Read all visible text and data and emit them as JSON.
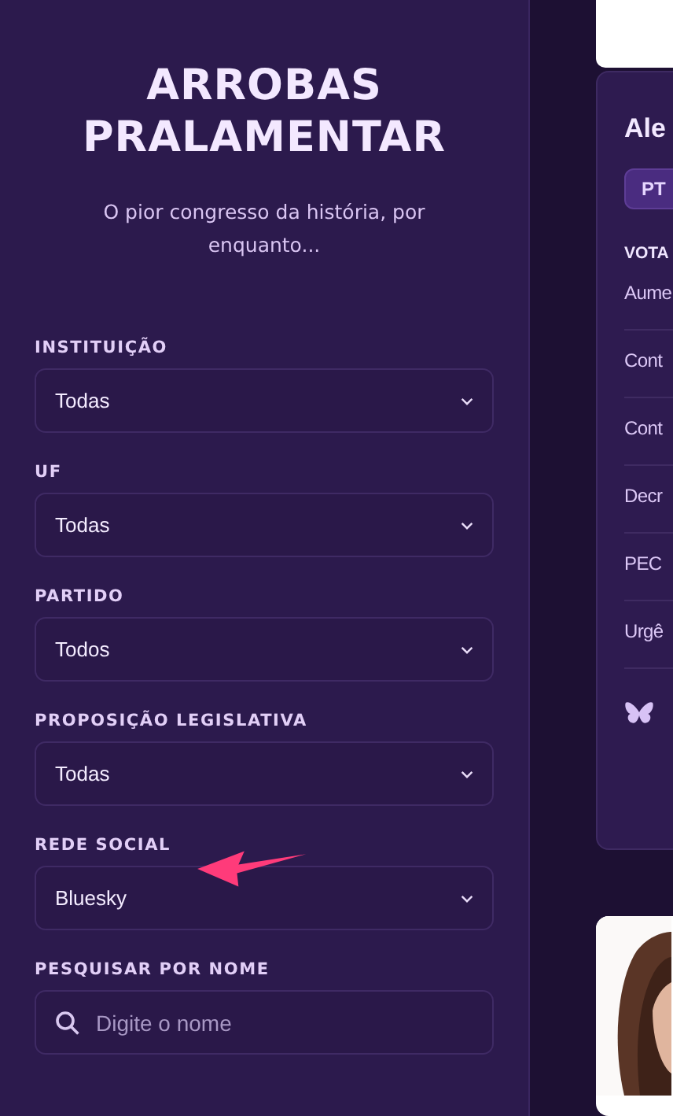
{
  "sidebar": {
    "title": "ARROBAS PRALAMENTAR",
    "subtitle": "O pior congresso da história, por enquanto...",
    "filters": [
      {
        "kind": "select",
        "label": "INSTITUIÇÃO",
        "value": "Todas"
      },
      {
        "kind": "select",
        "label": "UF",
        "value": "Todas"
      },
      {
        "kind": "select",
        "label": "PARTIDO",
        "value": "Todos"
      },
      {
        "kind": "select",
        "label": "PROPOSIÇÃO LEGISLATIVA",
        "value": "Todas"
      },
      {
        "kind": "select",
        "label": "REDE SOCIAL",
        "value": "Bluesky"
      },
      {
        "kind": "search",
        "label": "PESQUISAR POR NOME",
        "placeholder": "Digite o nome"
      }
    ]
  },
  "card": {
    "name": "Ale",
    "party": "PT",
    "section": "VOTA",
    "votes": [
      "Aume",
      "Cont",
      "Cont",
      "Decr",
      "PEC",
      "Urgê"
    ]
  }
}
